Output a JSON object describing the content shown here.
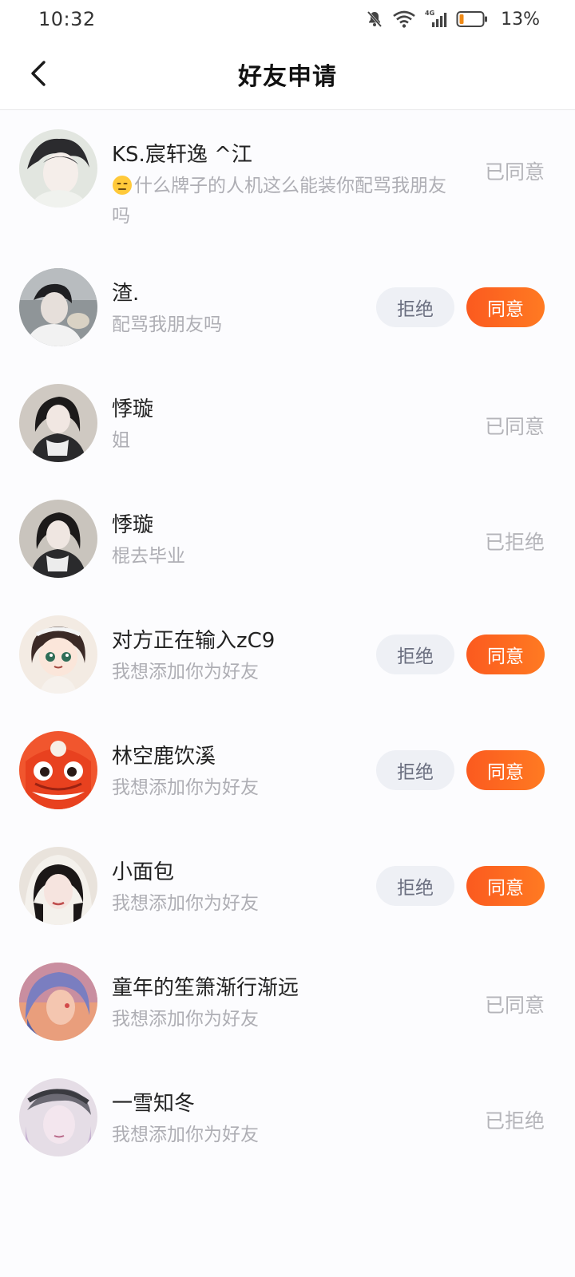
{
  "status_bar": {
    "time": "10:32",
    "battery": "13%",
    "network": "4G",
    "icons": [
      "mute-bell-icon",
      "wifi-icon",
      "cellular-signal-icon",
      "battery-icon"
    ]
  },
  "header": {
    "title": "好友申请",
    "back_icon": "chevron-left-icon"
  },
  "buttons": {
    "reject_label": "拒绝",
    "accept_label": "同意"
  },
  "colors": {
    "accent": "#fb5a1f",
    "accent_end": "#ff7a22",
    "reject_bg": "#eef0f5",
    "muted_text": "#aeaeb4"
  },
  "requests": [
    {
      "nickname": "KS.宸轩逸 ^江",
      "message": "什么牌子的人机这么能装你配骂我朋友吗",
      "message_emoji": "expressionless-face-emoji",
      "status": "已同意",
      "pending": false
    },
    {
      "nickname": "渣.",
      "message": "配骂我朋友吗",
      "status": "",
      "pending": true
    },
    {
      "nickname": "悸璇",
      "message": "姐",
      "status": "已同意",
      "pending": false
    },
    {
      "nickname": "悸璇",
      "message": "棍去毕业",
      "status": "已拒绝",
      "pending": false
    },
    {
      "nickname": "对方正在输入zC9",
      "message": "我想添加你为好友",
      "status": "",
      "pending": true
    },
    {
      "nickname": "林空鹿饮溪",
      "message": "我想添加你为好友",
      "status": "",
      "pending": true
    },
    {
      "nickname": "小面包",
      "message": "我想添加你为好友",
      "status": "",
      "pending": true
    },
    {
      "nickname": "童年的笙箫渐行渐远",
      "message": "我想添加你为好友",
      "status": "已同意",
      "pending": false
    },
    {
      "nickname": "一雪知冬",
      "message": "我想添加你为好友",
      "status": "已拒绝",
      "pending": false
    }
  ]
}
